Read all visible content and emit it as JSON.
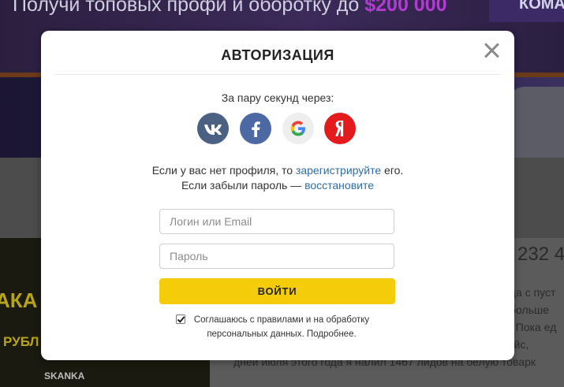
{
  "background": {
    "banner_text": "Получи топовых профи и оборотку до",
    "banner_money": "$200 000",
    "banner_right": "КОМА",
    "promo_big": "АКА",
    "promo_small": "РУБЛ",
    "promo_brand": "SKANKA",
    "number_fragment": "232 4",
    "paragraph_lines": [
      "ца с пуст",
      "больше",
      "! Пока ед",
      "пассажирском сидении решил написать небольшой кейс,",
      "дней июля этого года я налил 1467 лидов на белую товарк"
    ]
  },
  "modal": {
    "title": "АВТОРИЗАЦИЯ",
    "social_label": "За пару секунд через:",
    "socials": [
      {
        "name": "vk",
        "icon": "vk-icon",
        "color": "#4a6184"
      },
      {
        "name": "facebook",
        "icon": "facebook-icon",
        "color": "#4d69a4"
      },
      {
        "name": "google",
        "icon": "google-icon",
        "color": "#eeeeee"
      },
      {
        "name": "yandex",
        "icon": "yandex-icon",
        "color": "#e31b1c"
      }
    ],
    "no_profile_text": "Если у вас нет профиля, то",
    "register_link": "зарегистрируйте",
    "no_profile_tail": "его.",
    "forgot_text": "Если забыли пароль —",
    "restore_link": "восстановите",
    "login_placeholder": "Логин или Email",
    "password_placeholder": "Пароль",
    "login_button": "ВОЙТИ",
    "agree_checked": true,
    "agree_text": "Соглашаюсь с правилами и на обработку персональных данных. Подробнее."
  },
  "colors": {
    "accent_yellow": "#f5cc0a",
    "link_blue": "#2e6da6"
  }
}
